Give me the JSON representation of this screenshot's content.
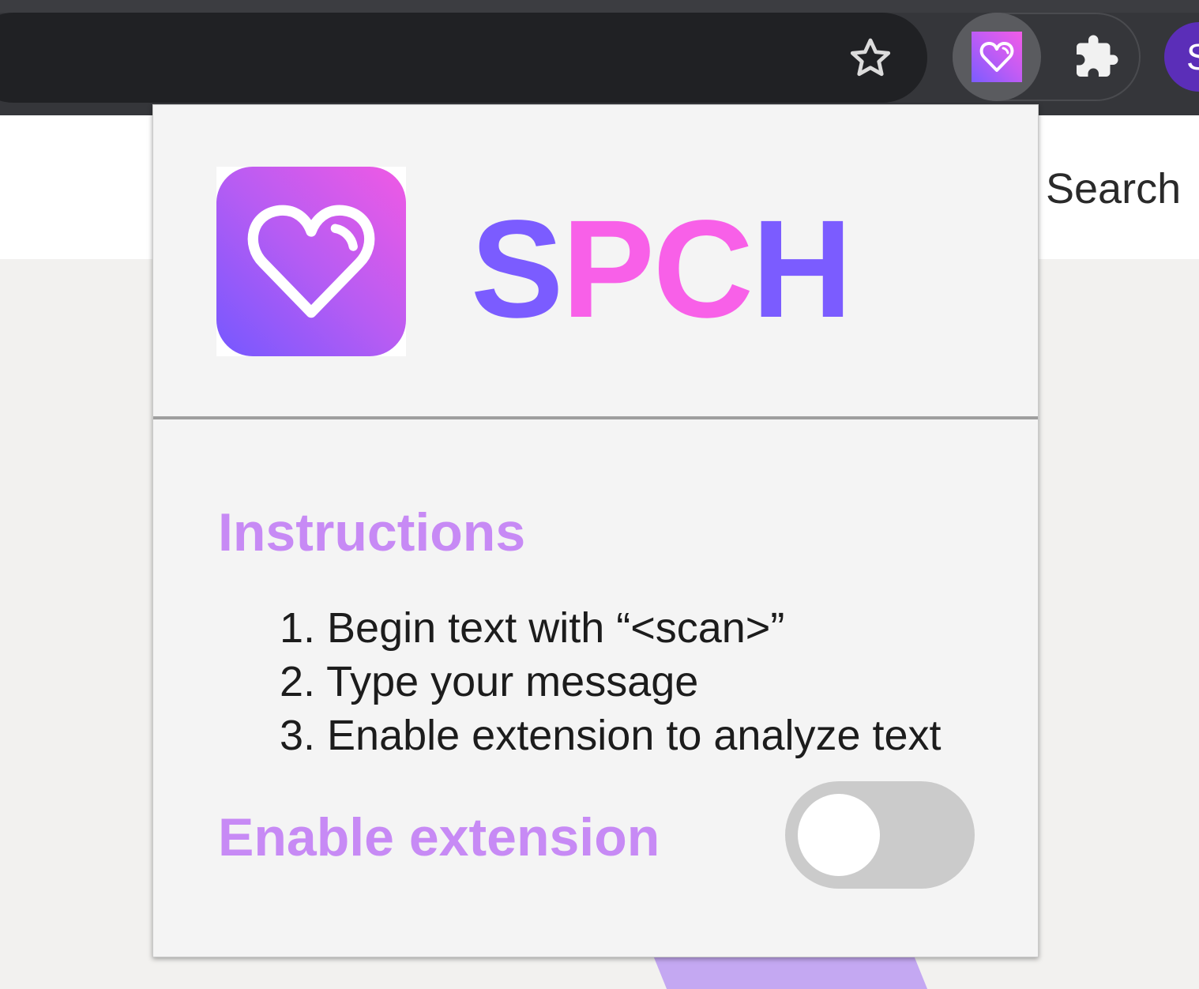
{
  "browser": {
    "star_icon": "star-outline-icon",
    "extension_icon": "heart-icon",
    "extensions_menu_icon": "puzzle-icon",
    "profile_initial": "S"
  },
  "page": {
    "search_label": "Search"
  },
  "popup": {
    "logo_icon": "heart-icon",
    "brand": {
      "part1": "S",
      "part2": "PC",
      "part3": "H"
    },
    "instructions_title": "Instructions",
    "steps": [
      "1. Begin text with “<scan>”",
      "2. Type your message",
      "3. Enable extension to analyze text"
    ],
    "enable_label": "Enable extension",
    "toggle_enabled": false
  },
  "colors": {
    "brand_purple": "#7b5cff",
    "brand_pink": "#f860e8",
    "heading_lilac": "#c78af5",
    "toggle_off": "#cbcbcb"
  }
}
